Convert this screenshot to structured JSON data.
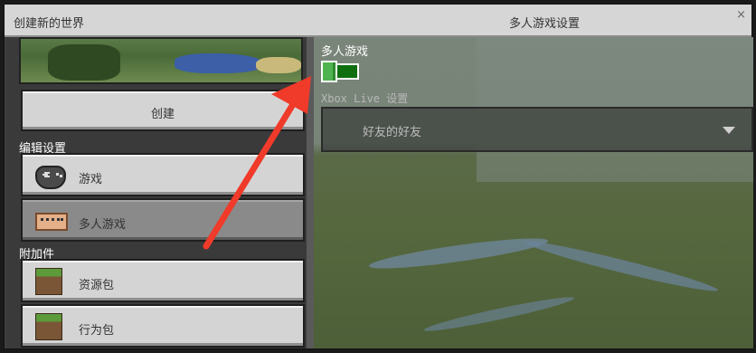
{
  "window": {
    "left_title": "创建新的世界",
    "center_title": "多人游戏设置",
    "close": "×"
  },
  "left": {
    "create_label": "创建",
    "edit_section": "编辑设置",
    "game_label": "游戏",
    "multiplayer_label": "多人游戏",
    "addons_section": "附加件",
    "resource_pack_label": "资源包",
    "behavior_pack_label": "行为包"
  },
  "right": {
    "multiplayer_title": "多人游戏",
    "multiplayer_enabled": true,
    "xbox_live_label": "Xbox Live 设置",
    "dropdown_value": "好友的好友"
  },
  "colors": {
    "toggle_on": "#0f6f0f",
    "annotation": "#f03a2a"
  },
  "icons": {
    "game": "gamepad-icon",
    "multiplayer": "players-faces-icon",
    "resource_pack": "grass-block-icon",
    "behavior_pack": "grass-block-icon",
    "dropdown": "chevron-down-icon"
  }
}
